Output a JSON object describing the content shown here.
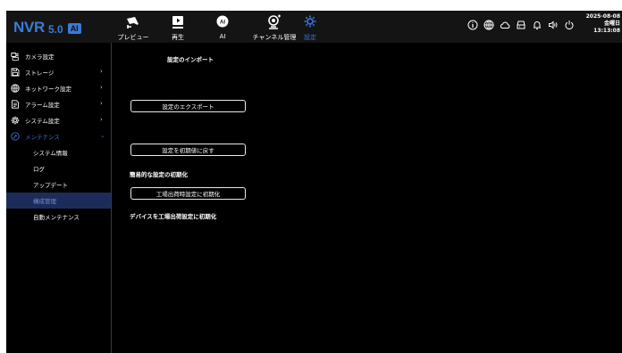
{
  "logo": {
    "name": "NVR",
    "version": "5.0",
    "badge": "AI"
  },
  "nav_tabs": [
    {
      "label": "プレビュー",
      "icon": "camera-icon",
      "active": false
    },
    {
      "label": "再生",
      "icon": "playback-icon",
      "active": false
    },
    {
      "label": "AI",
      "icon": "ai-icon",
      "active": false
    },
    {
      "label": "チャンネル管理",
      "icon": "channel-icon",
      "active": false
    },
    {
      "label": "設定",
      "icon": "gear-icon",
      "active": true
    }
  ],
  "status_icons": [
    "info-icon",
    "globe-icon",
    "cloud-icon",
    "storage-icon",
    "bell-icon",
    "speaker-icon",
    "power-icon"
  ],
  "datetime": {
    "date": "2025-08-08",
    "weekday": "金曜日",
    "time": "13:13:08"
  },
  "sidebar": {
    "items": [
      {
        "label": "カメラ設定",
        "icon": "camera-settings-icon",
        "has_chevron": false
      },
      {
        "label": "ストレージ",
        "icon": "storage-icon",
        "has_chevron": true
      },
      {
        "label": "ネットワーク設定",
        "icon": "network-icon",
        "has_chevron": true
      },
      {
        "label": "アラーム設定",
        "icon": "alarm-icon",
        "has_chevron": true
      },
      {
        "label": "システム設定",
        "icon": "system-gear-icon",
        "has_chevron": true
      },
      {
        "label": "メンテナンス",
        "icon": "maintenance-icon",
        "has_chevron": true
      }
    ],
    "maintenance_sub": [
      {
        "label": "システム情報",
        "selected": false
      },
      {
        "label": "ログ",
        "selected": false
      },
      {
        "label": "アップデート",
        "selected": false
      },
      {
        "label": "構成管理",
        "selected": true
      },
      {
        "label": "自動メンテナンス",
        "selected": false
      }
    ]
  },
  "main": {
    "import_title": "設定のインポート",
    "export_button": "設定のエクスポート",
    "reset_default_button": "設定を初期値に戻す",
    "simple_reset_desc": "簡易的な設定の初期化",
    "factory_reset_button": "工場出荷時設定に初期化",
    "factory_reset_desc": "デバイスを工場出荷設定に初期化"
  },
  "colors": {
    "accent": "#3a6fd8",
    "selected_bg": "#1c2c5a",
    "topbar_bg": "#141414",
    "background": "#000000"
  }
}
